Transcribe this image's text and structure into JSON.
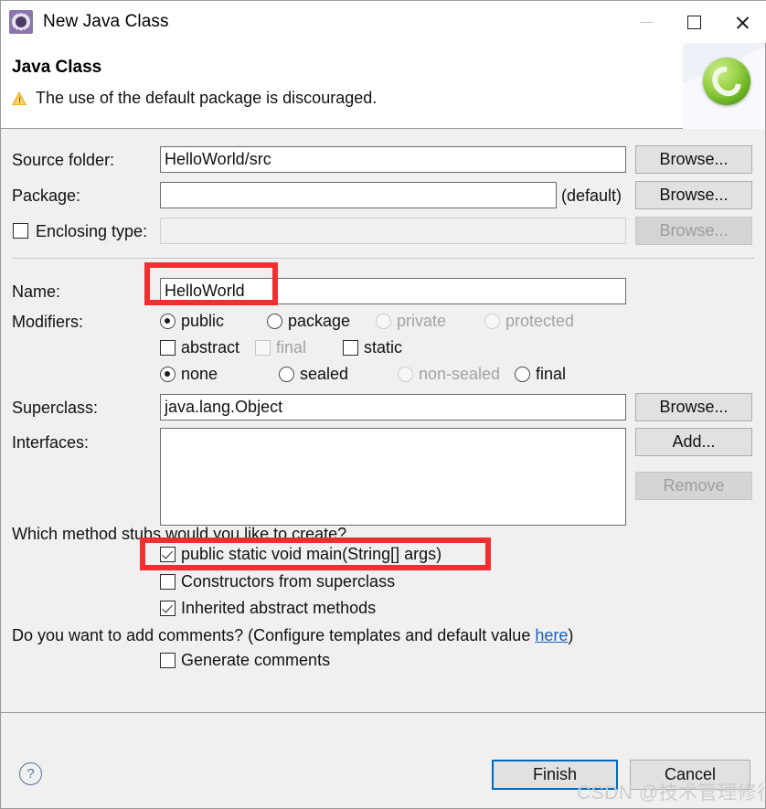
{
  "window": {
    "title": "New Java Class",
    "icon": "java-class-wizard-icon",
    "controls": {
      "minimize": "minimize-icon",
      "maximize": "maximize-icon",
      "close": "close-icon"
    }
  },
  "header": {
    "title": "Java Class",
    "message": "The use of the default package is discouraged.",
    "message_icon": "warning-icon",
    "banner_icon": "eclipse-java-class-banner-icon"
  },
  "form": {
    "source_folder": {
      "label": "Source folder:",
      "value": "HelloWorld/src",
      "placeholder": "",
      "browse": "Browse..."
    },
    "package": {
      "label": "Package:",
      "value": "",
      "placeholder": "",
      "suffix": "(default)",
      "browse": "Browse..."
    },
    "enclosing_type": {
      "label": "Enclosing type:",
      "checked": false,
      "value": "",
      "placeholder": "",
      "browse": "Browse...",
      "disabled": true
    },
    "name": {
      "label": "Name:",
      "value": "HelloWorld",
      "placeholder": ""
    },
    "modifiers": {
      "label": "Modifiers:",
      "access": [
        {
          "label": "public",
          "checked": true,
          "disabled": false
        },
        {
          "label": "package",
          "checked": false,
          "disabled": false
        },
        {
          "label": "private",
          "checked": false,
          "disabled": true
        },
        {
          "label": "protected",
          "checked": false,
          "disabled": true
        }
      ],
      "flags": [
        {
          "label": "abstract",
          "checked": false,
          "disabled": false
        },
        {
          "label": "final",
          "checked": false,
          "disabled": true
        },
        {
          "label": "static",
          "checked": false,
          "disabled": false
        }
      ],
      "sealed": [
        {
          "label": "none",
          "checked": true,
          "disabled": false
        },
        {
          "label": "sealed",
          "checked": false,
          "disabled": false
        },
        {
          "label": "non-sealed",
          "checked": false,
          "disabled": true
        },
        {
          "label": "final",
          "checked": false,
          "disabled": false
        }
      ]
    },
    "superclass": {
      "label": "Superclass:",
      "value": "java.lang.Object",
      "placeholder": "",
      "browse": "Browse..."
    },
    "interfaces": {
      "label": "Interfaces:",
      "value": "",
      "add": "Add...",
      "remove": "Remove",
      "remove_disabled": true
    }
  },
  "stubs": {
    "question": "Which method stubs would you like to create?",
    "options": [
      {
        "label": "public static void main(String[] args)",
        "checked": true
      },
      {
        "label": "Constructors from superclass",
        "checked": false
      },
      {
        "label": "Inherited abstract methods",
        "checked": true
      }
    ]
  },
  "comments": {
    "question_prefix": "Do you want to add comments? (Configure templates and default value ",
    "link": "here",
    "question_suffix": ")",
    "generate": {
      "label": "Generate comments",
      "checked": false
    }
  },
  "footer": {
    "help": "?",
    "finish": "Finish",
    "cancel": "Cancel"
  },
  "watermark": "CSDN @技术管理修行",
  "colors": {
    "annotation": "#f03030",
    "focus": "#0069c0",
    "link": "#1560bd",
    "warning": "#f0ad20"
  }
}
